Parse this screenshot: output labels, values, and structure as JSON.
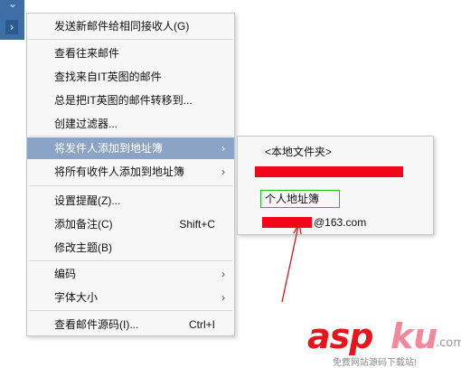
{
  "left_strip": {
    "top_icon": "chevron-icon",
    "mid_icon": "chevron-right-icon",
    "top_glyph": "⌄",
    "mid_glyph": "›"
  },
  "menu": {
    "items": [
      {
        "label": "发送新邮件给相同接收人(G)"
      },
      {
        "label": "查看往来邮件"
      },
      {
        "label": "查找来自IT英图的邮件"
      },
      {
        "label": "总是把IT英图的邮件转移到..."
      },
      {
        "label": "创建过滤器..."
      },
      {
        "label": "将发件人添加到地址簿",
        "submenu": true,
        "highlighted": true
      },
      {
        "label": "将所有收件人添加到地址簿",
        "submenu": true
      },
      {
        "label": "设置提醒(Z)..."
      },
      {
        "label": "添加备注(C)",
        "shortcut": "Shift+C"
      },
      {
        "label": "修改主题(B)"
      },
      {
        "label": "编码",
        "submenu": true
      },
      {
        "label": "字体大小",
        "submenu": true
      },
      {
        "label": "查看邮件源码(I)...",
        "shortcut": "Ctrl+I"
      }
    ],
    "arrow_glyph": "›"
  },
  "submenu": {
    "items": [
      {
        "label": "<本地文件夹>"
      },
      {
        "label": ""
      },
      {
        "label": "个人地址簿"
      },
      {
        "label": "@163.com"
      }
    ]
  },
  "watermark": {
    "asp": "asp",
    "ku": "ku",
    "com": ".com",
    "tagline": "免费网站源码下载站!"
  },
  "colors": {
    "highlight": "#8ba3c4",
    "redaction": "#f2071a",
    "box": "#20c020",
    "arrow": "#d01818",
    "strip": "#3d6ea5"
  }
}
